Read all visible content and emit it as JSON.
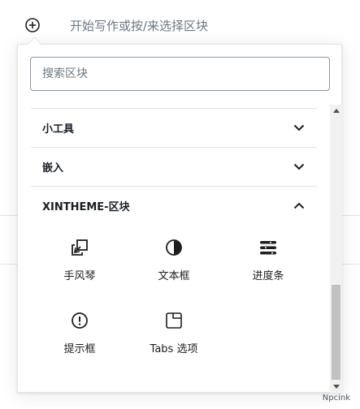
{
  "editor": {
    "placeholder": "开始写作或按/来选择区块"
  },
  "inserter": {
    "search": {
      "placeholder": "搜索区块",
      "value": ""
    },
    "sections": [
      {
        "title": "小工具",
        "expanded": false
      },
      {
        "title": "嵌入",
        "expanded": false
      },
      {
        "title": "XINTHEME-区块",
        "expanded": true
      }
    ],
    "blocks": [
      {
        "label": "手风琴",
        "icon": "duplicate-icon"
      },
      {
        "label": "文本框",
        "icon": "contrast-icon"
      },
      {
        "label": "进度条",
        "icon": "bars-icon"
      },
      {
        "label": "提示框",
        "icon": "alert-icon"
      },
      {
        "label": "Tabs 选项",
        "icon": "tab-square-icon"
      }
    ]
  },
  "watermark": "Npcink",
  "colors": {
    "text": "#1e1e1e",
    "muted": "#6c7781",
    "border": "#e2e4e7",
    "scroll_thumb": "#c1c1c1"
  }
}
